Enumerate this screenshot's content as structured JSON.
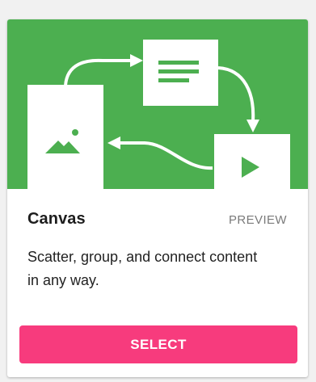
{
  "card": {
    "title": "Canvas",
    "badge": "PREVIEW",
    "description": "Scatter, group, and connect content in any way.",
    "select_label": "SELECT"
  },
  "colors": {
    "illustration_bg": "#4caf50",
    "accent": "#f73b7d",
    "page_bg": "#f1f1f1"
  },
  "icons": [
    "image-icon",
    "text-lines-icon",
    "play-icon",
    "arrow-icon"
  ]
}
